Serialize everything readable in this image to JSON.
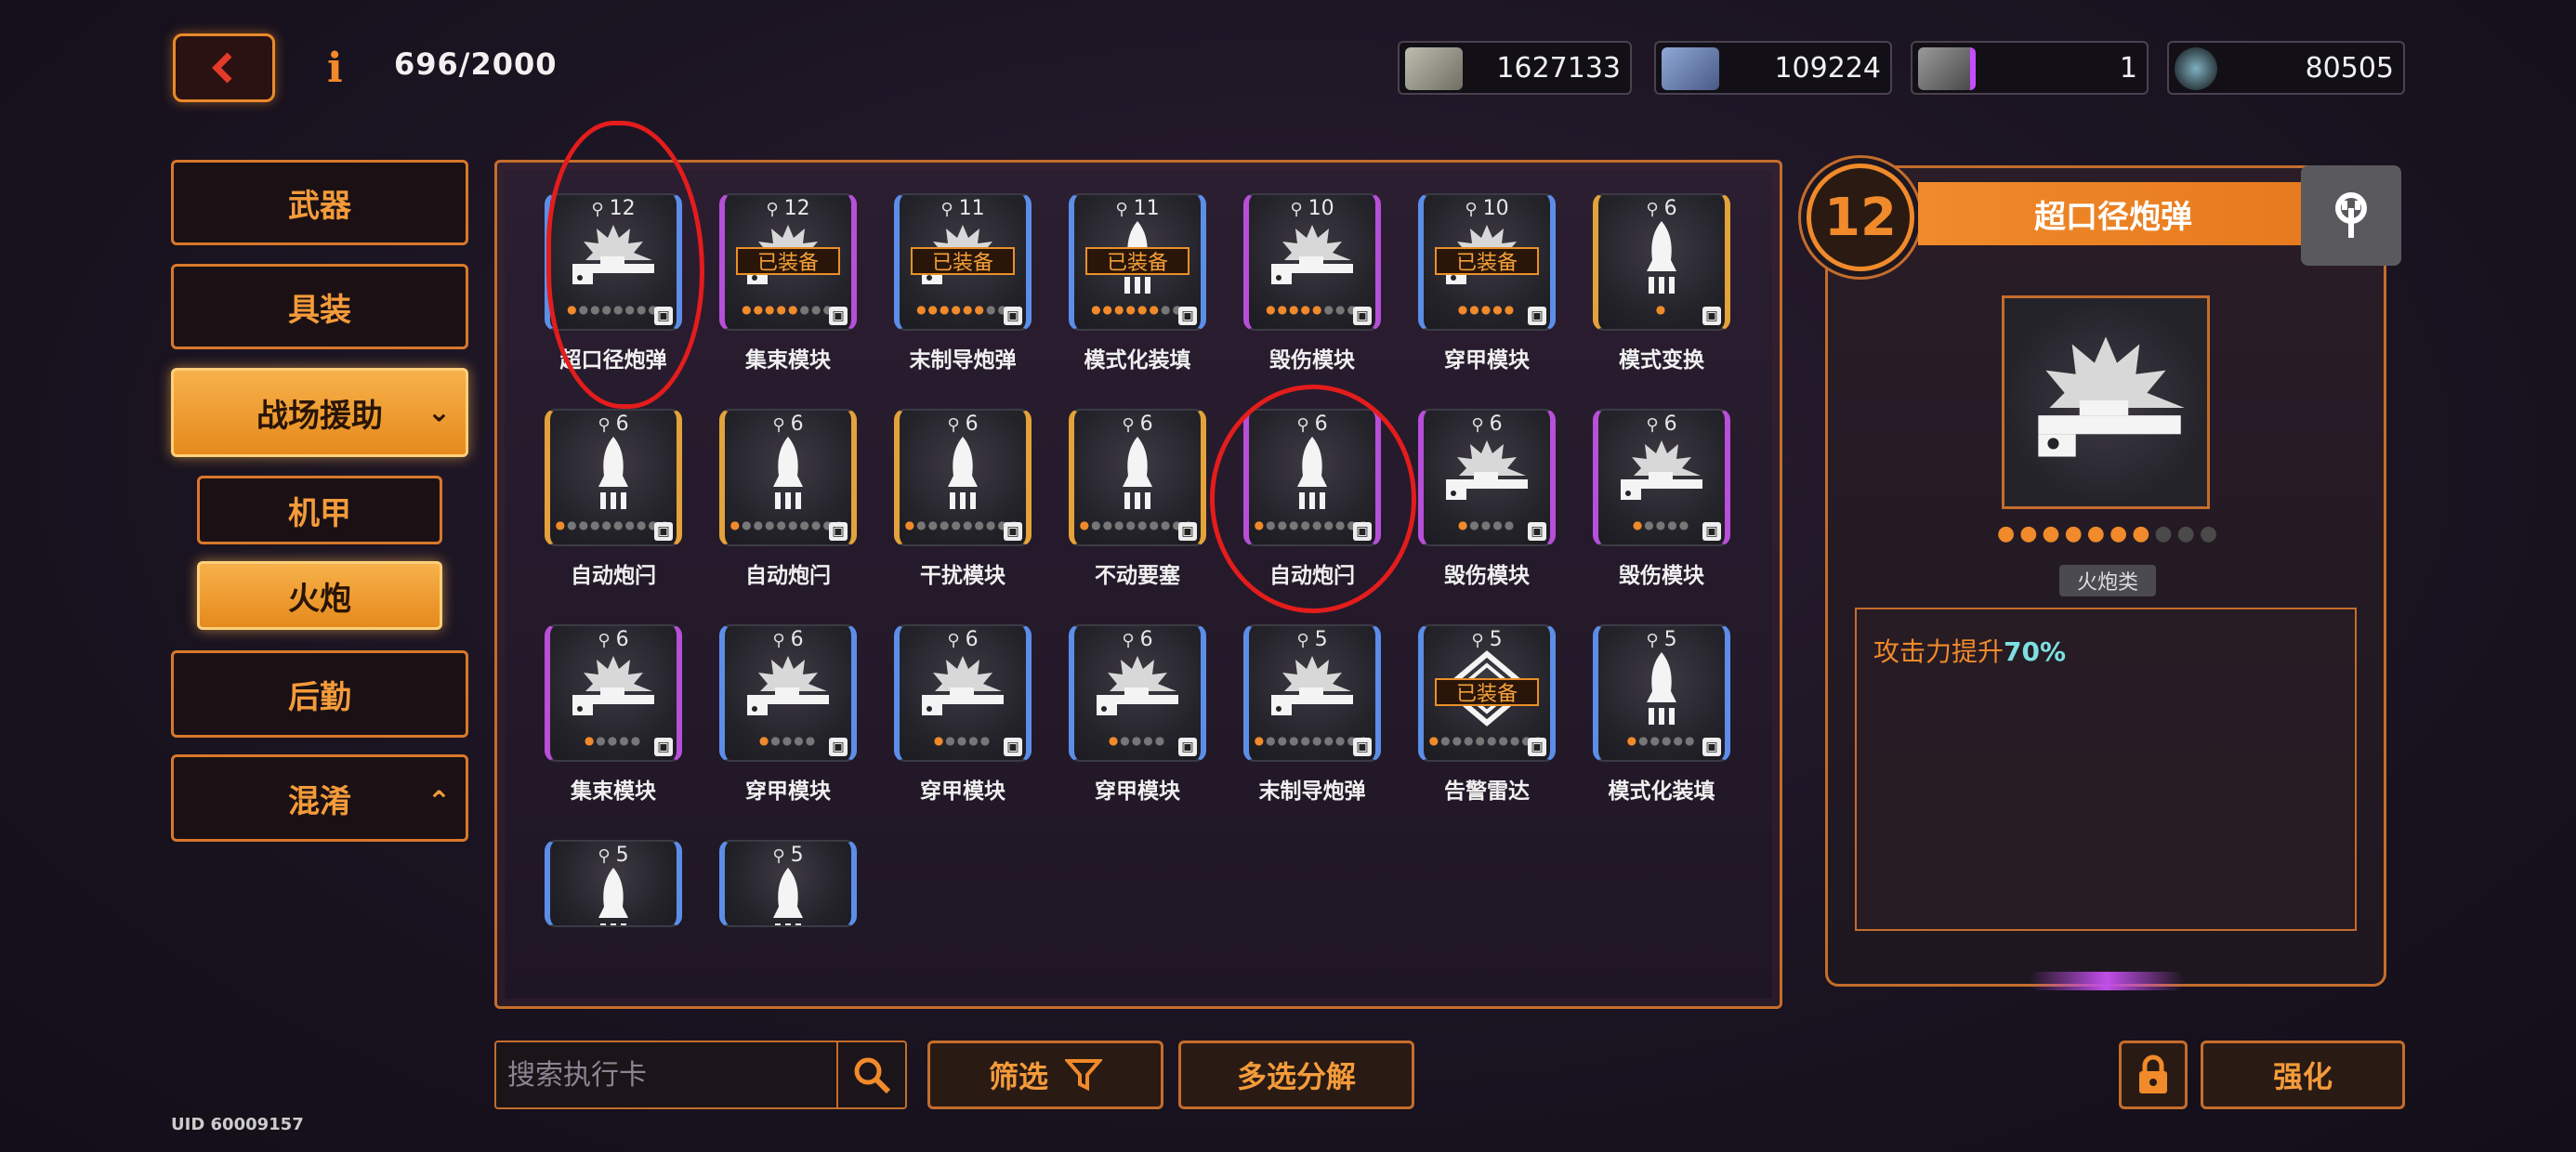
{
  "header": {
    "count": "696/2000",
    "info_icon": "i"
  },
  "currencies": [
    {
      "icon": "cash-bundle-icon",
      "value": "1627133"
    },
    {
      "icon": "crystal-block-icon",
      "value": "109224"
    },
    {
      "icon": "battery-card-icon",
      "value": "1"
    },
    {
      "icon": "gear-core-icon",
      "value": "80505"
    }
  ],
  "menu": {
    "weapon": "武器",
    "armor": "具装",
    "support": "战场援助",
    "mecha": "机甲",
    "artillery": "火炮",
    "logistics": "后勤",
    "mixed": "混淆"
  },
  "cards": [
    {
      "level": "12",
      "name": "超口径炮弹",
      "art": "cannon",
      "equipped": false,
      "frame": "blue",
      "filled": 1,
      "dots": 8
    },
    {
      "level": "12",
      "name": "集束模块",
      "art": "cannon",
      "equipped": true,
      "frame": "purple",
      "filled": 5,
      "dots": 8
    },
    {
      "level": "11",
      "name": "末制导炮弹",
      "art": "cannon",
      "equipped": true,
      "frame": "blue",
      "filled": 6,
      "dots": 8
    },
    {
      "level": "11",
      "name": "模式化装填",
      "art": "rocket",
      "equipped": true,
      "frame": "blue",
      "filled": 6,
      "dots": 8
    },
    {
      "level": "10",
      "name": "毁伤模块",
      "art": "cannon",
      "equipped": false,
      "frame": "purple",
      "filled": 5,
      "dots": 8
    },
    {
      "level": "10",
      "name": "穿甲模块",
      "art": "cannon",
      "equipped": true,
      "frame": "blue",
      "filled": 5,
      "dots": 5
    },
    {
      "level": "6",
      "name": "模式变换",
      "art": "rocket",
      "equipped": false,
      "frame": "gold",
      "filled": 1,
      "dots": 1
    },
    {
      "level": "6",
      "name": "自动炮闩",
      "art": "rocket",
      "equipped": false,
      "frame": "gold",
      "filled": 1,
      "dots": 10
    },
    {
      "level": "6",
      "name": "自动炮闩",
      "art": "rocket",
      "equipped": false,
      "frame": "gold",
      "filled": 1,
      "dots": 10
    },
    {
      "level": "6",
      "name": "干扰模块",
      "art": "rocket",
      "equipped": false,
      "frame": "gold",
      "filled": 1,
      "dots": 10
    },
    {
      "level": "6",
      "name": "不动要塞",
      "art": "rocket",
      "equipped": false,
      "frame": "gold",
      "filled": 1,
      "dots": 10
    },
    {
      "level": "6",
      "name": "自动炮闩",
      "art": "rocket",
      "equipped": false,
      "frame": "purple",
      "filled": 1,
      "dots": 10
    },
    {
      "level": "6",
      "name": "毁伤模块",
      "art": "cannon",
      "equipped": false,
      "frame": "purple",
      "filled": 1,
      "dots": 5
    },
    {
      "level": "6",
      "name": "毁伤模块",
      "art": "cannon",
      "equipped": false,
      "frame": "purple",
      "filled": 1,
      "dots": 5
    },
    {
      "level": "6",
      "name": "集束模块",
      "art": "cannon",
      "equipped": false,
      "frame": "purple",
      "filled": 1,
      "dots": 5
    },
    {
      "level": "6",
      "name": "穿甲模块",
      "art": "cannon",
      "equipped": false,
      "frame": "blue",
      "filled": 1,
      "dots": 5
    },
    {
      "level": "6",
      "name": "穿甲模块",
      "art": "cannon",
      "equipped": false,
      "frame": "blue",
      "filled": 1,
      "dots": 5
    },
    {
      "level": "6",
      "name": "穿甲模块",
      "art": "cannon",
      "equipped": false,
      "frame": "blue",
      "filled": 1,
      "dots": 5
    },
    {
      "level": "5",
      "name": "末制导炮弹",
      "art": "cannon",
      "equipped": false,
      "frame": "blue",
      "filled": 1,
      "dots": 10
    },
    {
      "level": "5",
      "name": "告警雷达",
      "art": "radar",
      "equipped": true,
      "frame": "blue",
      "filled": 1,
      "dots": 10
    },
    {
      "level": "5",
      "name": "模式化装填",
      "art": "rocket",
      "equipped": false,
      "frame": "blue",
      "filled": 1,
      "dots": 6
    },
    {
      "level": "5",
      "name": "",
      "art": "rocket",
      "equipped": false,
      "frame": "blue",
      "filled": 0,
      "dots": 0
    },
    {
      "level": "5",
      "name": "",
      "art": "rocket",
      "equipped": false,
      "frame": "blue",
      "filled": 0,
      "dots": 0
    }
  ],
  "equipped_label": "已装备",
  "detail": {
    "level": "12",
    "title": "超口径炮弹",
    "category": "火炮类",
    "desc_prefix": "攻击力提升",
    "desc_value": "70%",
    "progress_filled": 7,
    "progress_total": 10
  },
  "bottom": {
    "search_placeholder": "搜索执行卡",
    "filter": "筛选",
    "multi_decompose": "多选分解",
    "upgrade": "强化",
    "uid": "UID 60009157"
  },
  "colors": {
    "accent": "#f08a2a",
    "annotation": "#e41c1c"
  }
}
